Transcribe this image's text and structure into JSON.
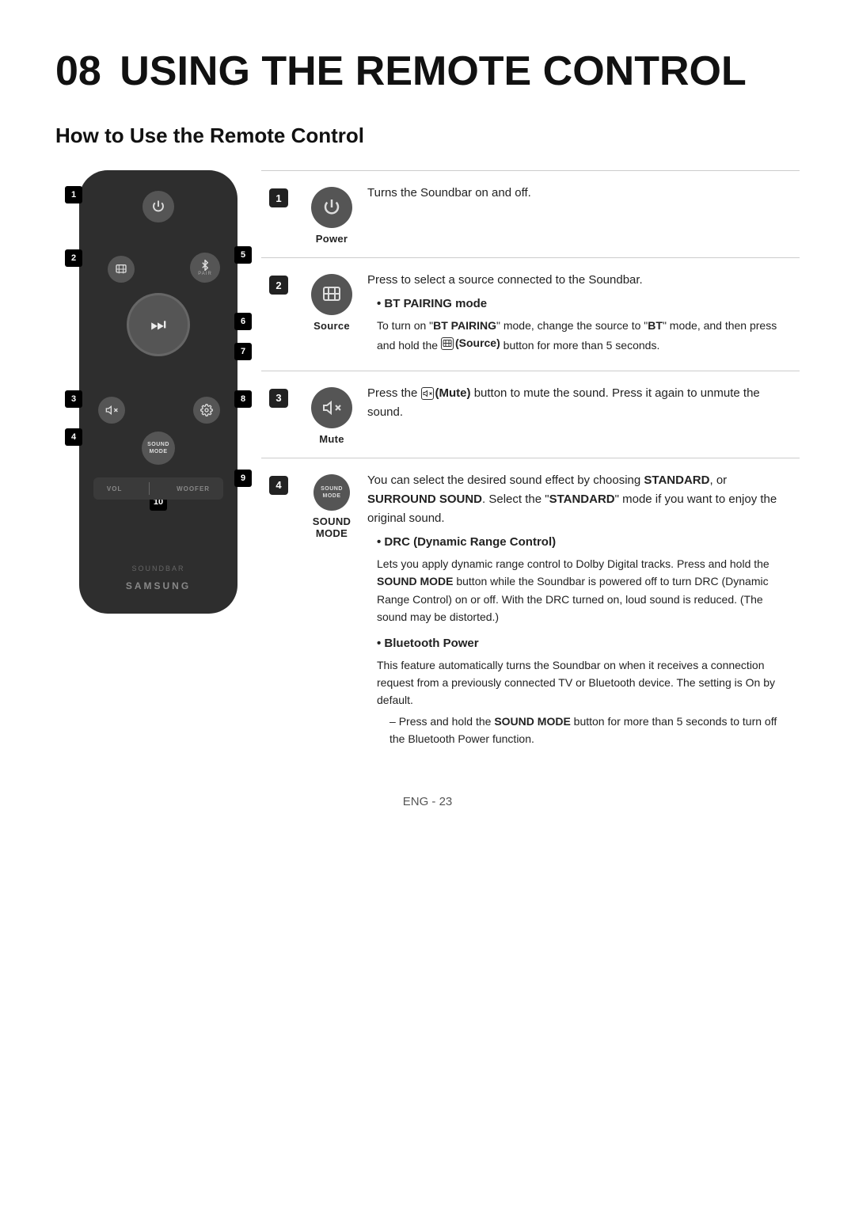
{
  "page": {
    "chapter": "08",
    "title": "USING THE REMOTE CONTROL",
    "section": "How to Use the Remote Control",
    "footer": "ENG - 23"
  },
  "remote": {
    "labels": {
      "samsung": "SAMSUNG",
      "soundbar": "SOUNDBAR",
      "vol": "VOL",
      "woofer": "WOOFER",
      "pair": "PAIR",
      "sound_mode": "SOUND\nMODE"
    },
    "numbers": [
      "1",
      "2",
      "3",
      "4",
      "5",
      "6",
      "7",
      "8",
      "9",
      "10"
    ]
  },
  "table": {
    "rows": [
      {
        "num": "1",
        "icon_label": "Power",
        "desc_main": "Turns the Soundbar on and off."
      },
      {
        "num": "2",
        "icon_label": "Source",
        "desc_main": "Press to select a source connected to the Soundbar.",
        "bullet1_title": "BT PAIRING mode",
        "bullet1_body": "To turn on \"BT PAIRING\" mode, change the source to \"BT\" mode, and then press and hold the",
        "bullet1_source": "(Source)",
        "bullet1_suffix": "button for more than 5 seconds."
      },
      {
        "num": "3",
        "icon_label": "Mute",
        "desc_main": "Press the",
        "desc_mute_label": "(Mute)",
        "desc_suffix": "button to mute the sound. Press it again to unmute the sound."
      },
      {
        "num": "4",
        "icon_label": "SOUND MODE",
        "desc_main": "You can select the desired sound effect by choosing STANDARD, or SURROUND SOUND. Select the \"STANDARD\" mode if you want to enjoy the original sound.",
        "bullet1_title": "DRC (Dynamic Range Control)",
        "bullet1_body": "Lets you apply dynamic range control to Dolby Digital tracks. Press and hold the SOUND MODE button while the Soundbar is powered off to turn DRC (Dynamic Range Control) on or off. With the DRC turned on, loud sound is reduced. (The sound may be distorted.)",
        "bullet2_title": "Bluetooth Power",
        "bullet2_body": "This feature automatically turns the Soundbar on when it receives a connection request from a previously connected TV or Bluetooth device. The setting is On by default.",
        "sub_bullet": "Press and hold the SOUND MODE button for more than 5 seconds to turn off the Bluetooth Power function."
      }
    ]
  }
}
